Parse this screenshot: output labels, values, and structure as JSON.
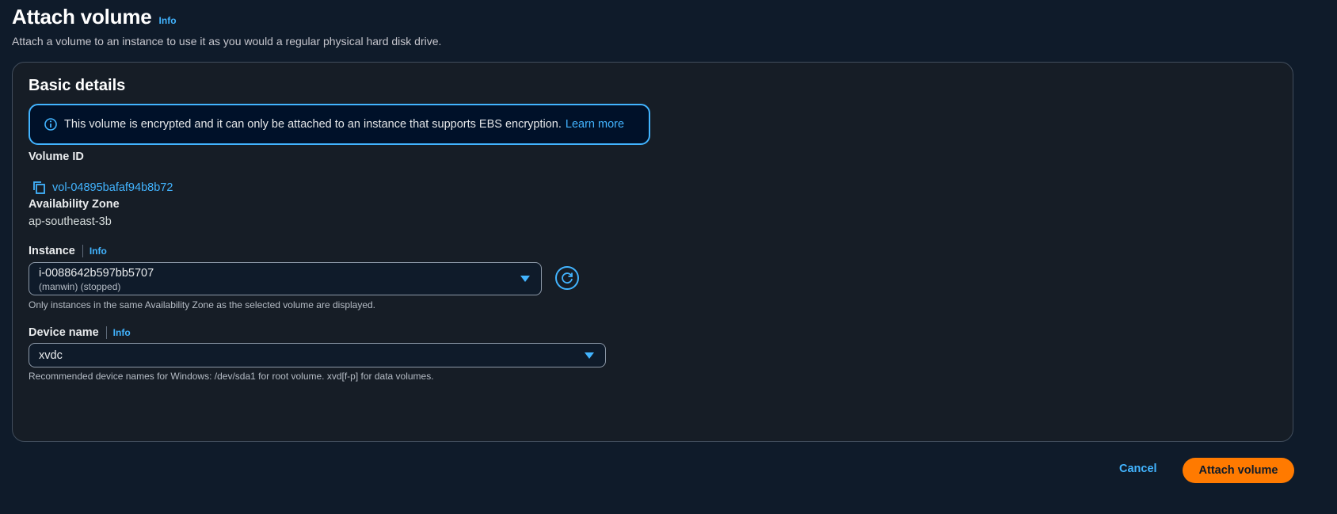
{
  "header": {
    "title": "Attach volume",
    "info": "Info",
    "description": "Attach a volume to an instance to use it as you would a regular physical hard disk drive."
  },
  "panel": {
    "title": "Basic details",
    "alert": {
      "text": "This volume is encrypted and it can only be attached to an instance that supports EBS encryption.",
      "link": "Learn more",
      "icon": "info-circle-icon"
    },
    "volume": {
      "label": "Volume ID",
      "value": "vol-04895bafaf94b8b72",
      "icon": "copy-icon"
    },
    "availability_zone": {
      "label": "Availability Zone",
      "value": "ap-southeast-3b"
    },
    "instance": {
      "label": "Instance",
      "info": "Info",
      "selected": "i-0088642b597bb5707",
      "selected_detail": "(manwin) (stopped)",
      "hint": "Only instances in the same Availability Zone as the selected volume are displayed.",
      "refresh_icon": "refresh-icon"
    },
    "device": {
      "label": "Device name",
      "info": "Info",
      "selected": "xvdc",
      "hint": "Recommended device names for Windows: /dev/sda1 for root volume. xvd[f-p] for data volumes."
    }
  },
  "footer": {
    "cancel": "Cancel",
    "attach": "Attach volume"
  },
  "colors": {
    "background": "#0f1b2a",
    "accent": "#42b4ff",
    "primary_button": "#ff7a00"
  }
}
